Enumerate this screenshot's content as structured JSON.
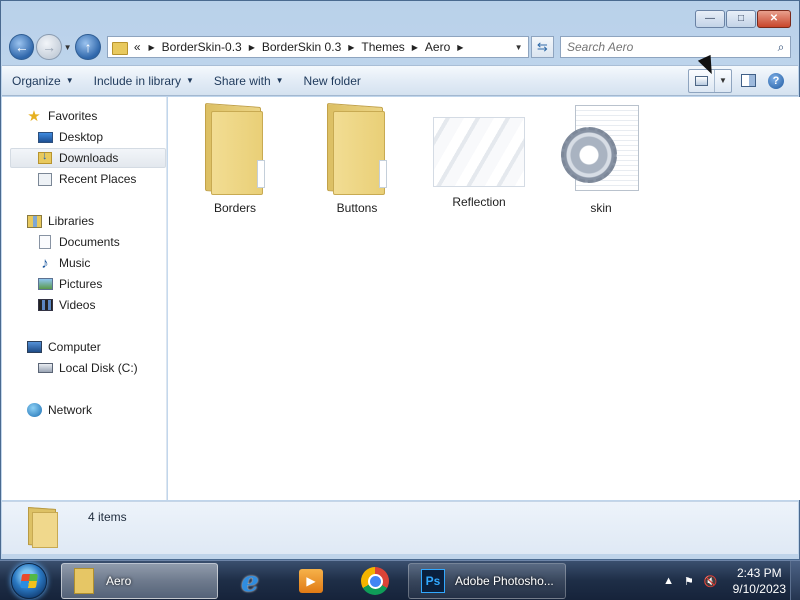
{
  "window": {
    "caption_buttons": [
      "minimize",
      "maximize",
      "close"
    ]
  },
  "nav": {
    "back_icon": "back-arrow-icon",
    "forward_icon": "forward-arrow-icon",
    "up_icon": "up-arrow-icon"
  },
  "address": {
    "overflow": "«",
    "segments": [
      "BorderSkin-0.3",
      "BorderSkin 0.3",
      "Themes",
      "Aero"
    ]
  },
  "search": {
    "placeholder": "Search Aero"
  },
  "toolbar": {
    "organize": "Organize",
    "include_in_library": "Include in library",
    "share_with": "Share with",
    "new_folder": "New folder"
  },
  "navpane": {
    "favorites": "Favorites",
    "desktop": "Desktop",
    "downloads": "Downloads",
    "recent_places": "Recent Places",
    "libraries": "Libraries",
    "documents": "Documents",
    "music": "Music",
    "pictures": "Pictures",
    "videos": "Videos",
    "computer": "Computer",
    "local_disk": "Local Disk (C:)",
    "network": "Network",
    "selected": "Downloads"
  },
  "files": [
    {
      "name": "Borders",
      "type": "folder"
    },
    {
      "name": "Buttons",
      "type": "folder"
    },
    {
      "name": "Reflection",
      "type": "image"
    },
    {
      "name": "skin",
      "type": "config"
    }
  ],
  "details": {
    "count_text": "4 items"
  },
  "taskbar": {
    "explorer_label": "Aero",
    "photoshop_icon_text": "Ps",
    "photoshop_label": "Adobe Photosho...",
    "time": "2:43 PM",
    "date": "9/10/2023"
  },
  "colors": {
    "accent": "#2f67ab",
    "folder": "#e8c95e",
    "taskbar": "#1e2e47"
  }
}
